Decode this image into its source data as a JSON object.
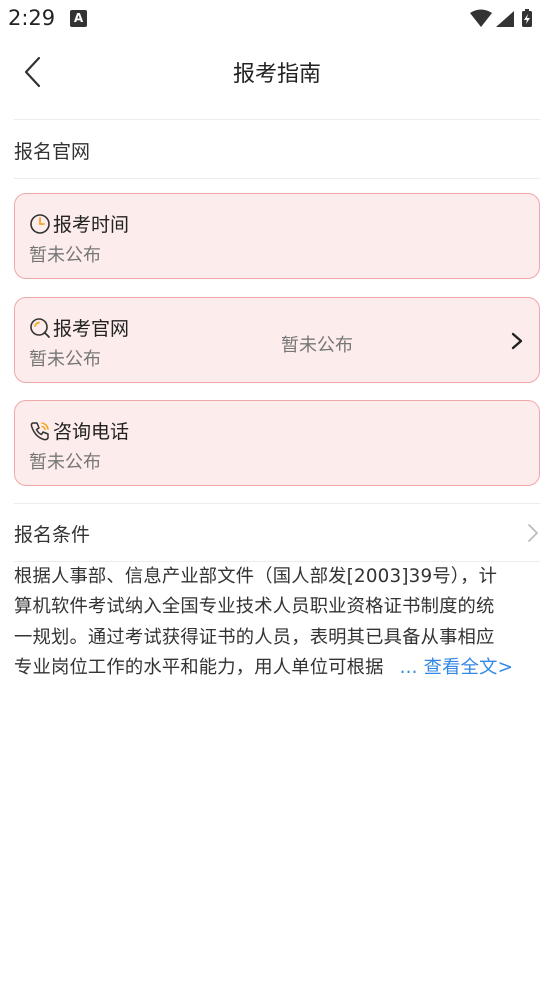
{
  "status": {
    "time": "2:29",
    "notif_letter": "A"
  },
  "header": {
    "title": "报考指南"
  },
  "official_site_section": {
    "label": "报名官网"
  },
  "cards": [
    {
      "title": "报考时间",
      "value": "暂未公布",
      "icon": "clock-icon"
    },
    {
      "title": "报考官网",
      "value": "暂未公布",
      "center_value": "暂未公布",
      "icon": "search-icon"
    },
    {
      "title": "咨询电话",
      "value": "暂未公布",
      "icon": "phone-icon"
    }
  ],
  "conditions": {
    "label": "报名条件",
    "lines": [
      "根据人事部、信息产业部文件（国人部发[2003]39号），计",
      "算机软件考试纳入全国专业技术人员职业资格证书制度的统",
      "一规划。通过考试获得证书的人员，表明其已具备从事相应",
      "专业岗位工作的水平和能力，用人单位可根据"
    ],
    "read_more": "... 查看全文>"
  },
  "colors": {
    "card_bg": "#fdecec",
    "card_border": "#f2a7ab",
    "icon_accent": "#f5a623",
    "link": "#3388e6"
  }
}
